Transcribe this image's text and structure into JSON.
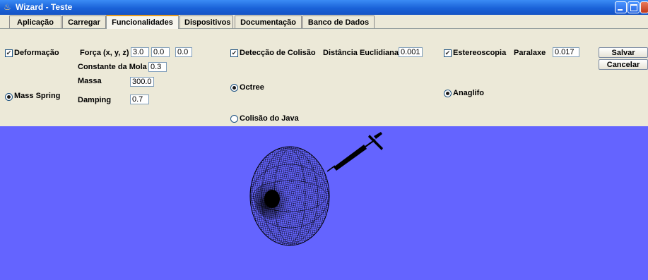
{
  "window": {
    "title": "Wizard - Teste",
    "icon": "java-cup-icon"
  },
  "tabs": [
    {
      "label": "Aplicação"
    },
    {
      "label": "Carregar"
    },
    {
      "label": "Funcionalidades"
    },
    {
      "label": "Dispositivos"
    },
    {
      "label": "Documentação"
    },
    {
      "label": "Banco de Dados"
    }
  ],
  "active_tab": "Funcionalidades",
  "deformacao": {
    "checkbox_label": "Deformação",
    "checked": true,
    "forca_label": "Força (x, y, z)",
    "forca_x": "3.0",
    "forca_y": "0.0",
    "forca_z": "0.0",
    "constante_label": "Constante da Mola",
    "constante_value": "0.3",
    "massa_label": "Massa",
    "massa_value": "300.0",
    "damping_label": "Damping",
    "damping_value": "0.7",
    "method_label": "Mass Spring",
    "method_selected": true
  },
  "colisao": {
    "checkbox_label": "Detecção de Colisão",
    "checked": true,
    "distancia_label": "Distância Euclidiana",
    "distancia_value": "0.0010",
    "octree_label": "Octree",
    "octree_selected": true,
    "java_label": "Colisão do Java",
    "java_selected": false
  },
  "estereoscopia": {
    "checkbox_label": "Estereoscopia",
    "checked": true,
    "paralaxe_label": "Paralaxe",
    "paralaxe_value": "0.017",
    "anaglifo_label": "Anaglifo",
    "anaglifo_selected": true
  },
  "buttons": {
    "save": "Salvar",
    "cancel": "Cancelar"
  },
  "colors": {
    "canvas_bg": "#6464ff",
    "panel_bg": "#ece9d8",
    "titlebar": "#1a62d8"
  }
}
